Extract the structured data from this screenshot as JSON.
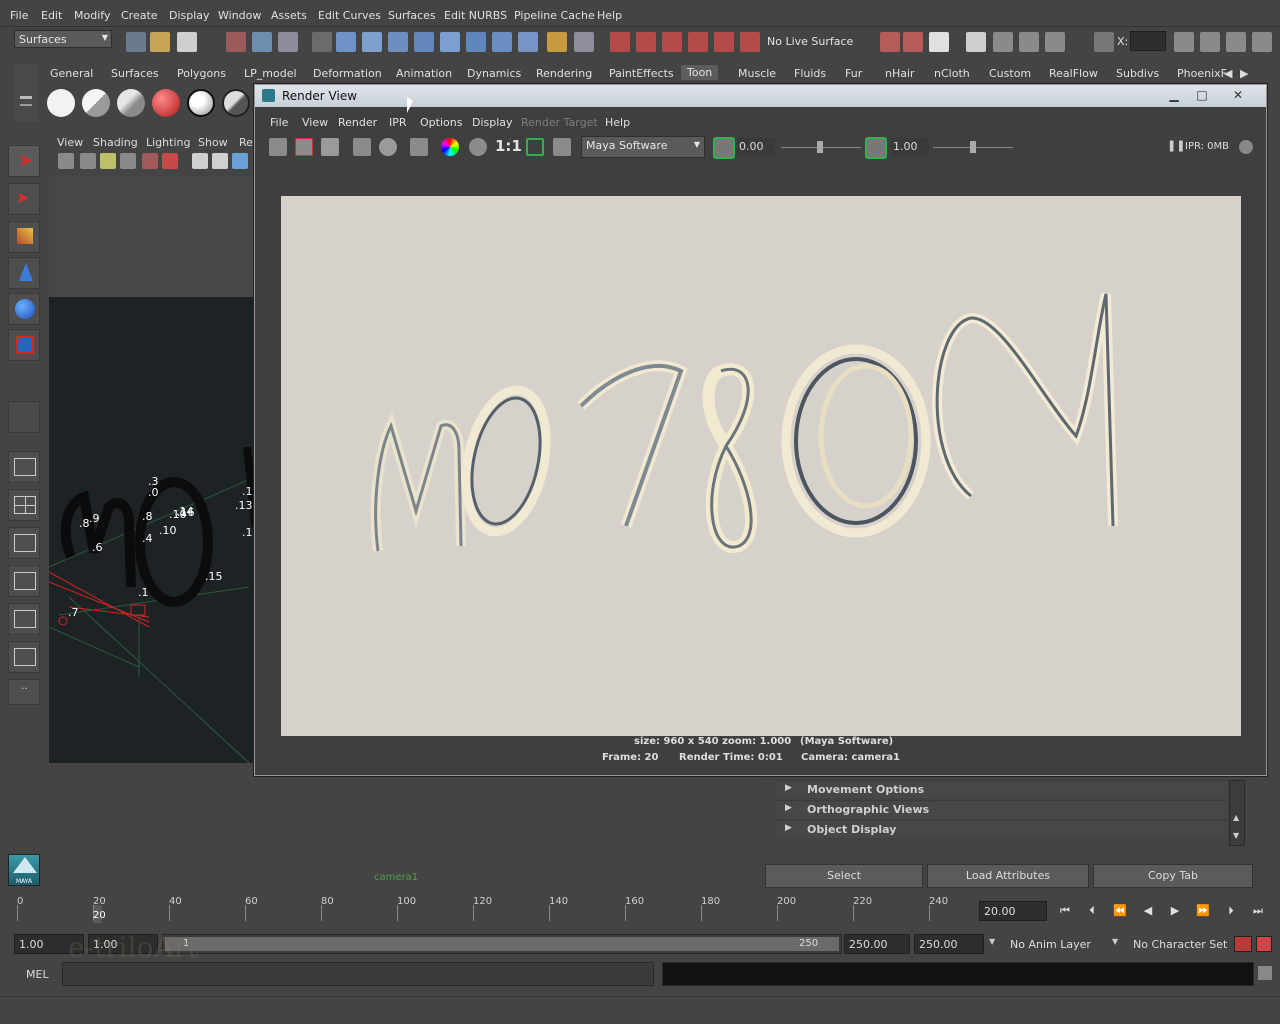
{
  "menu": [
    "File",
    "Edit",
    "Modify",
    "Create",
    "Display",
    "Window",
    "Assets",
    "Edit Curves",
    "Surfaces",
    "Edit NURBS",
    "Pipeline Cache",
    "Help"
  ],
  "status_line": {
    "mode": "Surfaces",
    "live_surface": "No Live Surface",
    "x_label": "X:"
  },
  "shelf_tabs": [
    "General",
    "Surfaces",
    "Polygons",
    "LP_model",
    "Deformation",
    "Animation",
    "Dynamics",
    "Rendering",
    "PaintEffects",
    "Toon",
    "Muscle",
    "Fluids",
    "Fur",
    "nHair",
    "nCloth",
    "Custom",
    "RealFlow",
    "Subdivs",
    "PhoenixF"
  ],
  "active_shelf": "Toon",
  "viewport": {
    "menu": [
      "View",
      "Shading",
      "Lighting",
      "Show",
      "Re"
    ],
    "camera_label": "camera1",
    "scene_labels": [
      ".3",
      ".0",
      ".9",
      ".8",
      ".8",
      ".10",
      ".4",
      ".16",
      ".14",
      ".6",
      ".10",
      ".1",
      ".13",
      ".1",
      ".15",
      ".1",
      ".7"
    ]
  },
  "render_view": {
    "title": "Render View",
    "menu": [
      "File",
      "View",
      "Render",
      "IPR",
      "Options",
      "Display",
      "Render Target",
      "Help"
    ],
    "ratio_label": "1:1",
    "renderer": "Maya Software",
    "exposure": "0.00",
    "gamma": "1.00",
    "ipr_status": "IPR: 0MB",
    "image_text": "MOTION",
    "info": {
      "size": "size: 960 x 540 zoom: 1.000",
      "renderer": "(Maya Software)",
      "frame": "Frame: 20",
      "time": "Render Time: 0:01",
      "camera": "Camera: camera1"
    }
  },
  "attribute_editor": {
    "sections": [
      "Movement Options",
      "Orthographic Views",
      "Object Display"
    ],
    "buttons": [
      "Select",
      "Load Attributes",
      "Copy Tab"
    ]
  },
  "timeline": {
    "ticks": [
      "0",
      "20",
      "40",
      "60",
      "80",
      "100",
      "120",
      "140",
      "160",
      "180",
      "200",
      "220",
      "240"
    ],
    "current_frame_marker": "20",
    "current_time": "20.00"
  },
  "range_slider": {
    "start": "1.00",
    "start2": "1.00",
    "range_start": "1",
    "range_end": "250",
    "end": "250.00",
    "end2": "250.00",
    "anim_layer": "No Anim Layer",
    "character_set": "No Character Set"
  },
  "command_line": {
    "label": "MEL"
  },
  "watermark": "e-triloArt",
  "maya_logo": "MAYA"
}
